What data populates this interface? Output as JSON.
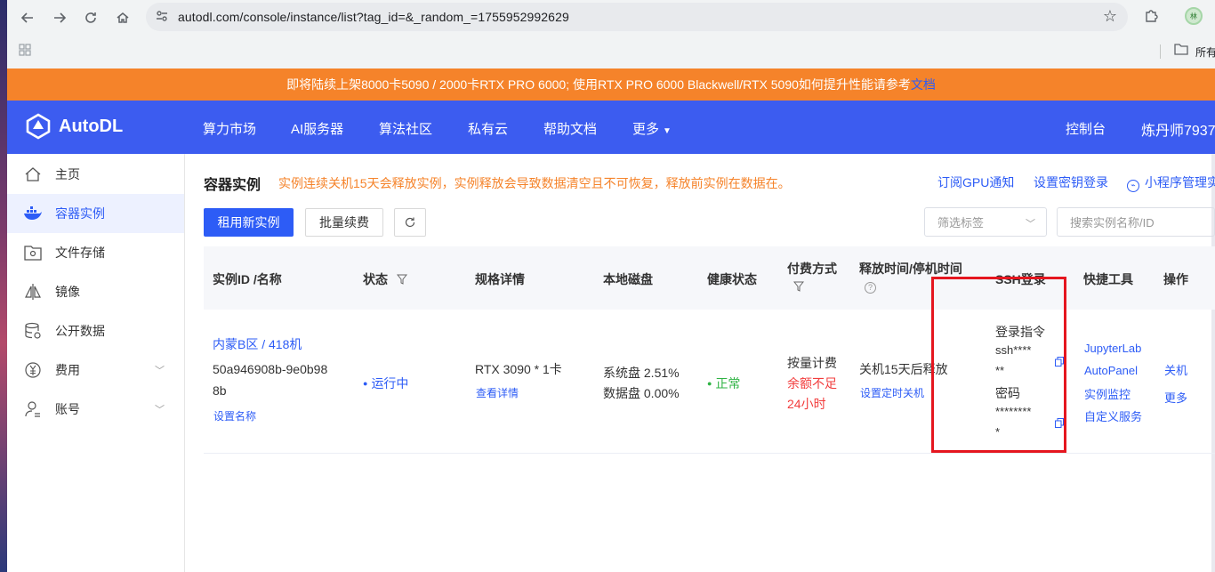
{
  "browser": {
    "url": "autodl.com/console/instance/list?tag_id=&_random_=1755952992629",
    "bookmark_label": "所有",
    "profile_initials": "林"
  },
  "announcement": {
    "text": "即将陆续上架8000卡5090 / 2000卡RTX PRO 6000; 使用RTX PRO 6000 Blackwell/RTX 5090如何提升性能请参考",
    "link": "文档"
  },
  "topnav": {
    "brand": "AutoDL",
    "items": [
      "算力市场",
      "AI服务器",
      "算法社区",
      "私有云",
      "帮助文档",
      "更多"
    ],
    "console": "控制台",
    "user": "炼丹师7937"
  },
  "sidebar": {
    "items": [
      {
        "label": "主页",
        "icon": "home-icon"
      },
      {
        "label": "容器实例",
        "icon": "docker-icon"
      },
      {
        "label": "文件存储",
        "icon": "storage-icon"
      },
      {
        "label": "镜像",
        "icon": "image-icon"
      },
      {
        "label": "公开数据",
        "icon": "database-icon"
      },
      {
        "label": "费用",
        "icon": "yen-icon"
      },
      {
        "label": "账号",
        "icon": "user-icon"
      }
    ]
  },
  "main": {
    "title": "容器实例",
    "warning": "实例连续关机15天会释放实例，实例释放会导致数据清空且不可恢复，释放前实例在数据在。",
    "links": {
      "gpu_notify": "订阅GPU通知",
      "ssh_key": "设置密钥登录",
      "miniprogram": "小程序管理实"
    },
    "buttons": {
      "rent": "租用新实例",
      "renew": "批量续费"
    },
    "filter_placeholder": "筛选标签",
    "search_placeholder": "搜索实例名称/ID"
  },
  "table": {
    "headers": {
      "id": "实例ID /名称",
      "status": "状态",
      "spec": "规格详情",
      "disk": "本地磁盘",
      "health": "健康状态",
      "pay": "付费方式",
      "release": "释放时间/停机时间",
      "ssh": "SSH登录",
      "tools": "快捷工具",
      "ops": "操作"
    },
    "row": {
      "region": "内蒙B区 / 418机",
      "id_line1": "50a946908b-9e0b98",
      "id_line2": "8b",
      "set_name": "设置名称",
      "status": "运行中",
      "gpu": "RTX 3090 * 1卡",
      "view_detail": "查看详情",
      "sys_disk": "系统盘 2.51%",
      "data_disk": "数据盘 0.00%",
      "health": "正常",
      "pay_type": "按量计费",
      "balance_warn_1": "余额不足",
      "balance_warn_2": "24小时",
      "release": "关机15天后释放",
      "set_shutdown": "设置定时关机",
      "login_cmd_label": "登录指令",
      "login_cmd_1": "ssh****",
      "login_cmd_2": "**",
      "password_label": "密码",
      "password_1": "********",
      "password_2": "*",
      "tools": [
        "JupyterLab",
        "AutoPanel",
        "实例监控",
        "自定义服务"
      ],
      "ops": [
        "关机",
        "更多"
      ]
    }
  },
  "colors": {
    "primary": "#2d5cf6",
    "nav_bg": "#3c5cf0",
    "announce_bg": "#f5832a",
    "warn": "#f5832a",
    "danger": "#f23c3c",
    "success": "#2fb344",
    "highlight": "#e5161f"
  }
}
